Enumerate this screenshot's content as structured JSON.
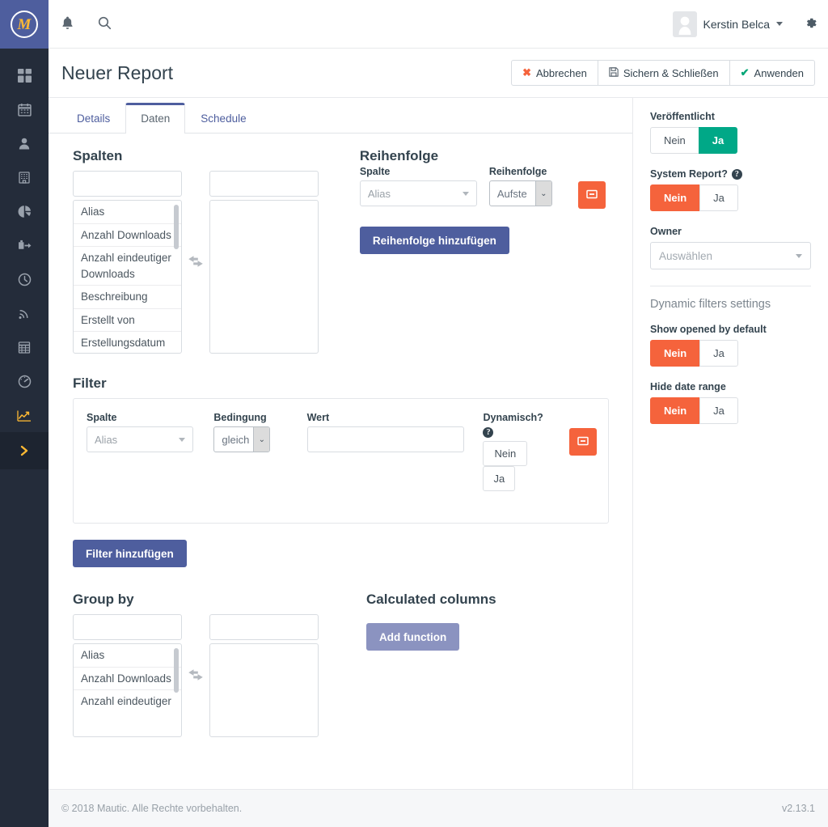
{
  "brand": {
    "logo_letter": "M"
  },
  "topbar": {
    "bell_icon": "bell-icon",
    "search_icon": "search-icon",
    "user_name": "Kerstin Belca",
    "gear_icon": "gear-icon"
  },
  "rail": {
    "items": [
      {
        "icon": "dashboard-icon",
        "name": "sidebar-item-dashboard"
      },
      {
        "icon": "calendar-icon",
        "name": "sidebar-item-calendar"
      },
      {
        "icon": "contacts-icon",
        "name": "sidebar-item-contacts"
      },
      {
        "icon": "companies-icon",
        "name": "sidebar-item-companies"
      },
      {
        "icon": "segments-icon",
        "name": "sidebar-item-segments"
      },
      {
        "icon": "campaigns-icon",
        "name": "sidebar-item-campaigns"
      },
      {
        "icon": "points-icon",
        "name": "sidebar-item-points"
      },
      {
        "icon": "stages-icon",
        "name": "sidebar-item-stages"
      },
      {
        "icon": "forms-icon",
        "name": "sidebar-item-forms"
      },
      {
        "icon": "gauge-icon",
        "name": "sidebar-item-gauge"
      },
      {
        "icon": "reports-icon",
        "name": "sidebar-item-reports"
      }
    ],
    "expander_icon": "chevron-right-icon"
  },
  "header": {
    "title": "Neuer Report",
    "buttons": [
      {
        "label": "Abbrechen",
        "icon": "cancel-x-icon"
      },
      {
        "label": "Sichern & Schließen",
        "icon": "save-icon"
      },
      {
        "label": "Anwenden",
        "icon": "check-icon"
      }
    ]
  },
  "tabs": [
    {
      "label": "Details",
      "active": false
    },
    {
      "label": "Daten",
      "active": true
    },
    {
      "label": "Schedule",
      "active": false
    }
  ],
  "columns_section": {
    "title": "Spalten",
    "search_placeholder": "",
    "search_value": "",
    "target_search_value": "",
    "available": [
      "Alias",
      "Anzahl Downloads",
      "Anzahl eindeutiger Downloads",
      "Beschreibung",
      "Erstellt von",
      "Erstellungsdatum"
    ],
    "selected": [],
    "swap_icon": "exchange-arrows-icon"
  },
  "order_section": {
    "title": "Reihenfolge",
    "column_label": "Spalte",
    "column_value": "Alias",
    "order_label": "Reihenfolge",
    "order_value": "Aufste",
    "remove_icon": "minus-square-icon",
    "add_button": "Reihenfolge hinzufügen"
  },
  "filter_section": {
    "title": "Filter",
    "column_label": "Spalte",
    "column_value": "Alias",
    "condition_label": "Bedingung",
    "condition_value": "gleich",
    "value_label": "Wert",
    "value_text": "",
    "value_placeholder": "",
    "dynamic_label": "Dynamisch?",
    "dynamic_help_icon": "question-mark-icon",
    "dynamic_no": "Nein",
    "dynamic_yes": "Ja",
    "remove_icon": "minus-square-icon",
    "add_button": "Filter hinzufügen"
  },
  "groupby_section": {
    "title": "Group by",
    "search_value": "",
    "target_search_value": "",
    "available": [
      "Alias",
      "Anzahl Downloads",
      "Anzahl eindeutiger"
    ],
    "selected": [],
    "swap_icon": "exchange-arrows-icon"
  },
  "calculated_section": {
    "title": "Calculated columns",
    "add_button": "Add function"
  },
  "side_panel": {
    "published_label": "Veröffentlicht",
    "published_no": "Nein",
    "published_yes": "Ja",
    "published_state": "Ja",
    "system_report_label": "System Report?",
    "system_report_help_icon": "question-mark-icon",
    "system_report_no": "Nein",
    "system_report_yes": "Ja",
    "system_report_state": "Nein",
    "owner_label": "Owner",
    "owner_value": "Auswählen",
    "dynamic_filters_heading": "Dynamic filters settings",
    "show_opened_label": "Show opened by default",
    "show_opened_no": "Nein",
    "show_opened_yes": "Ja",
    "show_opened_state": "Nein",
    "hide_date_label": "Hide date range",
    "hide_date_no": "Nein",
    "hide_date_yes": "Ja",
    "hide_date_state": "Nein"
  },
  "footer": {
    "copyright": "© 2018 Mautic. Alle Rechte vorbehalten.",
    "version": "v2.13.1"
  },
  "colors": {
    "rail_bg": "#242c3a",
    "brand_blue": "#4e5e9e",
    "brand_gold": "#fdb933",
    "accent_green": "#00a887",
    "accent_red": "#f5633c",
    "muted_purple": "#8b93c0"
  }
}
